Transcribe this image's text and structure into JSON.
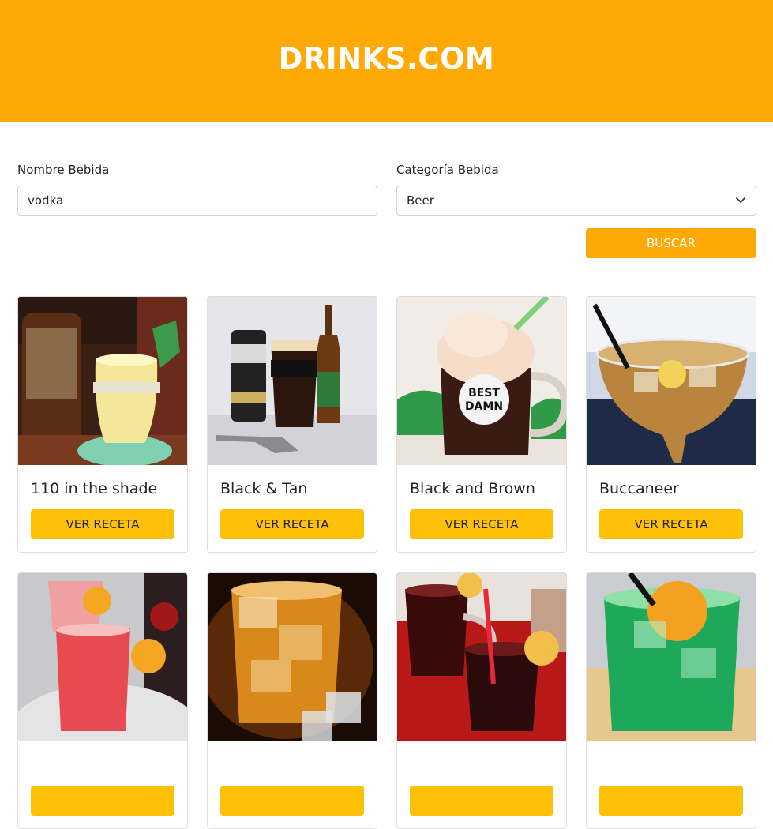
{
  "header": {
    "title": "DRINKS.COM",
    "bg_color": "#ffa907"
  },
  "form": {
    "name_label": "Nombre Bebida",
    "name_value": "vodka",
    "category_label": "Categoría Bebida",
    "category_value": "Beer",
    "search_label": "BUSCAR"
  },
  "cards": [
    {
      "name": "110 in the shade",
      "button": "VER RECETA"
    },
    {
      "name": "Black & Tan",
      "button": "VER RECETA"
    },
    {
      "name": "Black and Brown",
      "button": "VER RECETA"
    },
    {
      "name": "Buccaneer",
      "button": "VER RECETA"
    },
    {
      "name": "",
      "button": ""
    },
    {
      "name": "",
      "button": ""
    },
    {
      "name": "",
      "button": ""
    },
    {
      "name": "",
      "button": ""
    }
  ],
  "colors": {
    "accent": "#ffa907",
    "card_button": "#ffc107"
  }
}
